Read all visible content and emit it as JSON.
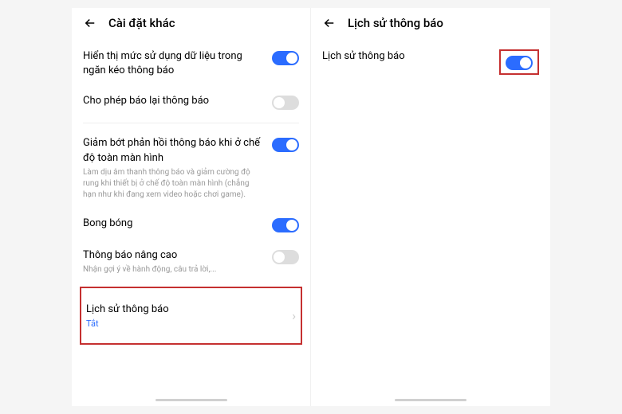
{
  "left": {
    "header": {
      "title": "Cài đặt khác"
    },
    "settings": {
      "dataUsage": {
        "title": "Hiển thị mức sử dụng dữ liệu trong ngăn kéo thông báo",
        "on": true
      },
      "allowSnooze": {
        "title": "Cho phép báo lại thông báo",
        "on": false
      },
      "fullscreen": {
        "title": "Giảm bớt phản hồi thông báo khi ở chế độ toàn màn hình",
        "desc": "Làm dịu âm thanh thông báo và giảm cường độ rung khi thiết bị ở chế độ toàn màn hình (chẳng hạn như khi đang xem video hoặc chơi game).",
        "on": true
      },
      "bubbles": {
        "title": "Bong bóng",
        "on": true
      },
      "advanced": {
        "title": "Thông báo nâng cao",
        "desc": "Nhận gợi ý về hành động, câu trả lời,...",
        "on": false
      },
      "history": {
        "title": "Lịch sử thông báo",
        "status": "Tắt"
      }
    }
  },
  "right": {
    "header": {
      "title": "Lịch sử thông báo"
    },
    "settings": {
      "history": {
        "title": "Lịch sử thông báo",
        "on": true
      }
    }
  }
}
